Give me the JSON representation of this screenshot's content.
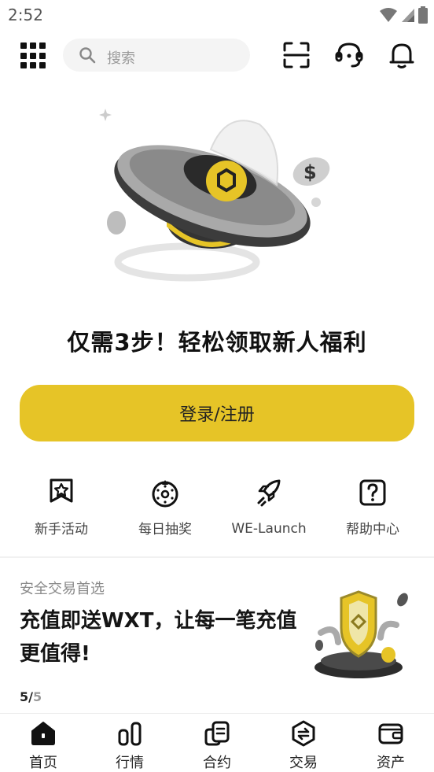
{
  "status_bar": {
    "time": "2:52"
  },
  "header": {
    "search_placeholder": "搜索"
  },
  "promo": {
    "title": "仅需3步！轻松领取新人福利",
    "login_label": "登录/注册"
  },
  "quick_actions": [
    {
      "label": "新手活动",
      "icon": "badge-icon"
    },
    {
      "label": "每日抽奖",
      "icon": "lottery-wheel-icon"
    },
    {
      "label": "WE-Launch",
      "icon": "rocket-icon"
    },
    {
      "label": "帮助中心",
      "icon": "help-icon"
    }
  ],
  "banner": {
    "subtitle": "安全交易首选",
    "title": "充值即送WXT，让每一笔充值更值得!",
    "page_current": "5/",
    "page_total": "5"
  },
  "bottom_nav": [
    {
      "label": "首页",
      "icon": "home-icon"
    },
    {
      "label": "行情",
      "icon": "market-icon"
    },
    {
      "label": "合约",
      "icon": "contract-icon"
    },
    {
      "label": "交易",
      "icon": "trade-icon"
    },
    {
      "label": "资产",
      "icon": "wallet-icon"
    }
  ],
  "colors": {
    "accent": "#e6c427",
    "text": "#111111",
    "muted": "#8a8a8a"
  }
}
